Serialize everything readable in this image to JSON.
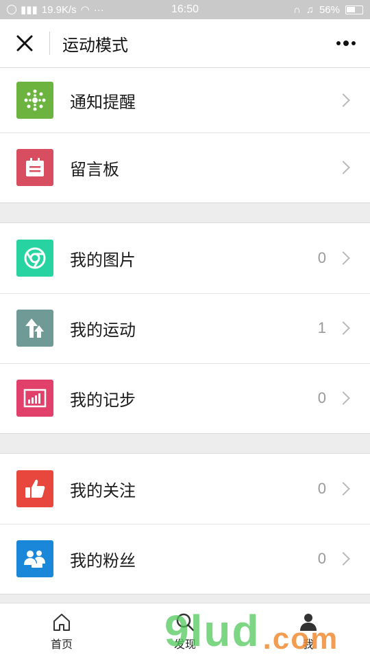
{
  "status": {
    "speed": "19.9K/s",
    "time": "16:50",
    "battery": "56%"
  },
  "nav": {
    "title": "运动模式"
  },
  "groups": [
    {
      "items": [
        {
          "label": "通知提醒",
          "count": "",
          "color": "#6db33f",
          "icon": "network-dots-icon"
        },
        {
          "label": "留言板",
          "count": "",
          "color": "#d94d60",
          "icon": "calendar-board-icon"
        }
      ]
    },
    {
      "items": [
        {
          "label": "我的图片",
          "count": "0",
          "color": "#27d3a0",
          "icon": "chrome-circle-icon"
        },
        {
          "label": "我的运动",
          "count": "1",
          "color": "#6f9a96",
          "icon": "up-arrows-icon"
        },
        {
          "label": "我的记步",
          "count": "0",
          "color": "#e0406a",
          "icon": "bar-chart-icon"
        }
      ]
    },
    {
      "items": [
        {
          "label": "我的关注",
          "count": "0",
          "color": "#e8473d",
          "icon": "thumbs-up-icon"
        },
        {
          "label": "我的粉丝",
          "count": "0",
          "color": "#1a87d8",
          "icon": "people-icon"
        }
      ]
    }
  ],
  "tabs": [
    {
      "label": "首页",
      "icon": "home-icon"
    },
    {
      "label": "发现",
      "icon": "search-icon"
    },
    {
      "label": "我",
      "icon": "user-icon"
    }
  ],
  "watermark": {
    "text": "9lud",
    "domain": ".com"
  }
}
